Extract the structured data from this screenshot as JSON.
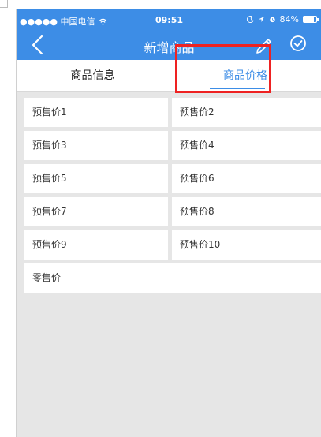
{
  "status_bar": {
    "carrier": "●●●●● 中国电信",
    "time": "09:51",
    "battery": "84%",
    "battery_level": 0.84
  },
  "header": {
    "title": "新增商品"
  },
  "tabs": [
    {
      "label": "商品信息",
      "active": false
    },
    {
      "label": "商品价格",
      "active": true
    }
  ],
  "price_fields": [
    {
      "placeholder": "预售价1"
    },
    {
      "placeholder": "预售价2"
    },
    {
      "placeholder": "预售价3"
    },
    {
      "placeholder": "预售价4"
    },
    {
      "placeholder": "预售价5"
    },
    {
      "placeholder": "预售价6"
    },
    {
      "placeholder": "预售价7"
    },
    {
      "placeholder": "预售价8"
    },
    {
      "placeholder": "预售价9"
    },
    {
      "placeholder": "预售价10"
    }
  ],
  "retail_field": {
    "placeholder": "零售价"
  },
  "colors": {
    "accent": "#3d8de6",
    "highlight": "#ee2222",
    "background": "#e6e6e6"
  },
  "icons": [
    "back-chevron-icon",
    "edit-pencil-icon",
    "confirm-check-icon",
    "wifi-icon",
    "moon-icon",
    "location-icon",
    "alarm-icon",
    "battery-icon"
  ]
}
